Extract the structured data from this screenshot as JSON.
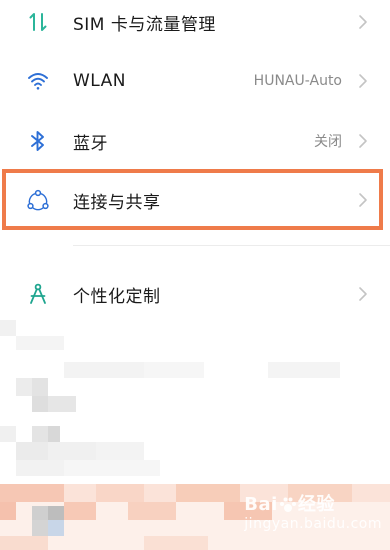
{
  "settings": {
    "items": [
      {
        "label": "SIM 卡与流量管理",
        "value": "",
        "icon": "sim-data-arrows-icon"
      },
      {
        "label": "WLAN",
        "value": "HUNAU-Auto",
        "icon": "wifi-icon"
      },
      {
        "label": "蓝牙",
        "value": "关闭",
        "icon": "bluetooth-icon"
      },
      {
        "label": "连接与共享",
        "value": "",
        "icon": "connection-sharing-icon"
      },
      {
        "label": "个性化定制",
        "value": "",
        "icon": "personalization-compass-icon"
      }
    ]
  },
  "colors": {
    "highlight_border": "#ef7b4a",
    "icon_green": "#2bb59a",
    "icon_blue": "#2d6fd6",
    "icon_teal": "#1fa58f"
  },
  "watermark": {
    "brand": "Bai",
    "brand_suffix": "经验",
    "sub": "jingyan.baidu.com"
  }
}
